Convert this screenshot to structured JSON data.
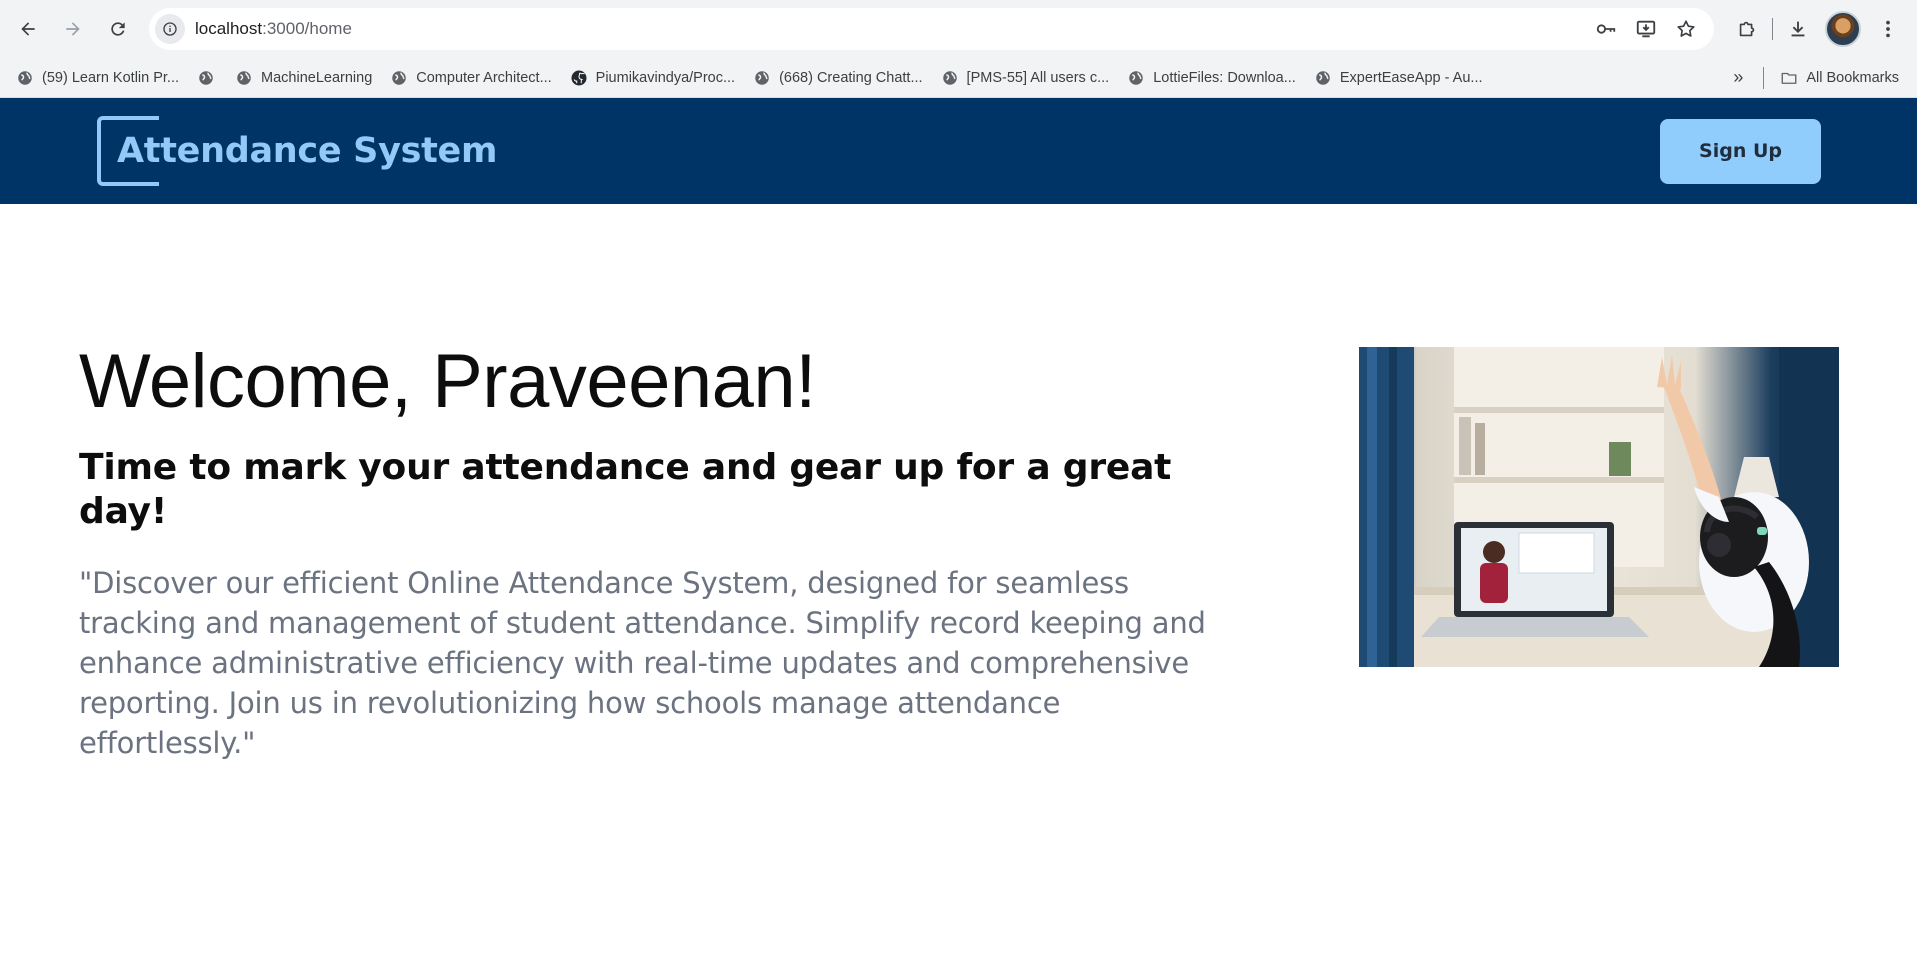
{
  "browser": {
    "url_host": "localhost",
    "url_path": ":3000/home",
    "bookmarks": [
      {
        "label": "(59) Learn Kotlin Pr...",
        "icon": "globe-icon"
      },
      {
        "label": "",
        "icon": "globe-icon"
      },
      {
        "label": "MachineLearning",
        "icon": "globe-icon"
      },
      {
        "label": "Computer Architect...",
        "icon": "globe-icon"
      },
      {
        "label": "Piumikavindya/Proc...",
        "icon": "github-icon"
      },
      {
        "label": "(668) Creating Chatt...",
        "icon": "globe-icon"
      },
      {
        "label": "[PMS-55] All users c...",
        "icon": "globe-icon"
      },
      {
        "label": "LottieFiles: Downloa...",
        "icon": "globe-icon"
      },
      {
        "label": "ExpertEaseApp - Au...",
        "icon": "globe-icon"
      }
    ],
    "more_bookmarks": "»",
    "all_bookmarks": "All Bookmarks"
  },
  "header": {
    "logo_text": "Attendance System",
    "signup_label": "Sign Up"
  },
  "hero": {
    "welcome": "Welcome, Praveenan!",
    "tagline": "Time to mark your attendance and gear up for a great day!",
    "description": "\"Discover our efficient Online Attendance System, designed for seamless tracking and management of student attendance. Simplify record keeping and enhance administrative efficiency with real-time updates and comprehensive reporting. Join us in revolutionizing how schools manage attendance effortlessly.\""
  },
  "colors": {
    "header_bg": "#003366",
    "accent_light_blue": "#93c9f8",
    "signup_bg": "#90cdfc",
    "description_gray": "#6b7280"
  }
}
